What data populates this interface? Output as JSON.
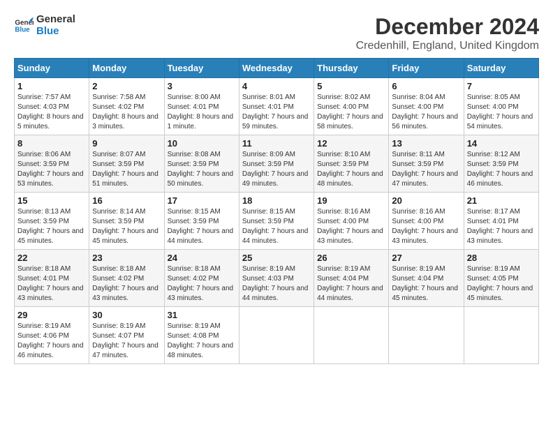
{
  "header": {
    "logo_line1": "General",
    "logo_line2": "Blue",
    "main_title": "December 2024",
    "subtitle": "Credenhill, England, United Kingdom"
  },
  "days_of_week": [
    "Sunday",
    "Monday",
    "Tuesday",
    "Wednesday",
    "Thursday",
    "Friday",
    "Saturday"
  ],
  "weeks": [
    [
      {
        "day": "1",
        "sunrise": "Sunrise: 7:57 AM",
        "sunset": "Sunset: 4:03 PM",
        "daylight": "Daylight: 8 hours and 5 minutes."
      },
      {
        "day": "2",
        "sunrise": "Sunrise: 7:58 AM",
        "sunset": "Sunset: 4:02 PM",
        "daylight": "Daylight: 8 hours and 3 minutes."
      },
      {
        "day": "3",
        "sunrise": "Sunrise: 8:00 AM",
        "sunset": "Sunset: 4:01 PM",
        "daylight": "Daylight: 8 hours and 1 minute."
      },
      {
        "day": "4",
        "sunrise": "Sunrise: 8:01 AM",
        "sunset": "Sunset: 4:01 PM",
        "daylight": "Daylight: 7 hours and 59 minutes."
      },
      {
        "day": "5",
        "sunrise": "Sunrise: 8:02 AM",
        "sunset": "Sunset: 4:00 PM",
        "daylight": "Daylight: 7 hours and 58 minutes."
      },
      {
        "day": "6",
        "sunrise": "Sunrise: 8:04 AM",
        "sunset": "Sunset: 4:00 PM",
        "daylight": "Daylight: 7 hours and 56 minutes."
      },
      {
        "day": "7",
        "sunrise": "Sunrise: 8:05 AM",
        "sunset": "Sunset: 4:00 PM",
        "daylight": "Daylight: 7 hours and 54 minutes."
      }
    ],
    [
      {
        "day": "8",
        "sunrise": "Sunrise: 8:06 AM",
        "sunset": "Sunset: 3:59 PM",
        "daylight": "Daylight: 7 hours and 53 minutes."
      },
      {
        "day": "9",
        "sunrise": "Sunrise: 8:07 AM",
        "sunset": "Sunset: 3:59 PM",
        "daylight": "Daylight: 7 hours and 51 minutes."
      },
      {
        "day": "10",
        "sunrise": "Sunrise: 8:08 AM",
        "sunset": "Sunset: 3:59 PM",
        "daylight": "Daylight: 7 hours and 50 minutes."
      },
      {
        "day": "11",
        "sunrise": "Sunrise: 8:09 AM",
        "sunset": "Sunset: 3:59 PM",
        "daylight": "Daylight: 7 hours and 49 minutes."
      },
      {
        "day": "12",
        "sunrise": "Sunrise: 8:10 AM",
        "sunset": "Sunset: 3:59 PM",
        "daylight": "Daylight: 7 hours and 48 minutes."
      },
      {
        "day": "13",
        "sunrise": "Sunrise: 8:11 AM",
        "sunset": "Sunset: 3:59 PM",
        "daylight": "Daylight: 7 hours and 47 minutes."
      },
      {
        "day": "14",
        "sunrise": "Sunrise: 8:12 AM",
        "sunset": "Sunset: 3:59 PM",
        "daylight": "Daylight: 7 hours and 46 minutes."
      }
    ],
    [
      {
        "day": "15",
        "sunrise": "Sunrise: 8:13 AM",
        "sunset": "Sunset: 3:59 PM",
        "daylight": "Daylight: 7 hours and 45 minutes."
      },
      {
        "day": "16",
        "sunrise": "Sunrise: 8:14 AM",
        "sunset": "Sunset: 3:59 PM",
        "daylight": "Daylight: 7 hours and 45 minutes."
      },
      {
        "day": "17",
        "sunrise": "Sunrise: 8:15 AM",
        "sunset": "Sunset: 3:59 PM",
        "daylight": "Daylight: 7 hours and 44 minutes."
      },
      {
        "day": "18",
        "sunrise": "Sunrise: 8:15 AM",
        "sunset": "Sunset: 3:59 PM",
        "daylight": "Daylight: 7 hours and 44 minutes."
      },
      {
        "day": "19",
        "sunrise": "Sunrise: 8:16 AM",
        "sunset": "Sunset: 4:00 PM",
        "daylight": "Daylight: 7 hours and 43 minutes."
      },
      {
        "day": "20",
        "sunrise": "Sunrise: 8:16 AM",
        "sunset": "Sunset: 4:00 PM",
        "daylight": "Daylight: 7 hours and 43 minutes."
      },
      {
        "day": "21",
        "sunrise": "Sunrise: 8:17 AM",
        "sunset": "Sunset: 4:01 PM",
        "daylight": "Daylight: 7 hours and 43 minutes."
      }
    ],
    [
      {
        "day": "22",
        "sunrise": "Sunrise: 8:18 AM",
        "sunset": "Sunset: 4:01 PM",
        "daylight": "Daylight: 7 hours and 43 minutes."
      },
      {
        "day": "23",
        "sunrise": "Sunrise: 8:18 AM",
        "sunset": "Sunset: 4:02 PM",
        "daylight": "Daylight: 7 hours and 43 minutes."
      },
      {
        "day": "24",
        "sunrise": "Sunrise: 8:18 AM",
        "sunset": "Sunset: 4:02 PM",
        "daylight": "Daylight: 7 hours and 43 minutes."
      },
      {
        "day": "25",
        "sunrise": "Sunrise: 8:19 AM",
        "sunset": "Sunset: 4:03 PM",
        "daylight": "Daylight: 7 hours and 44 minutes."
      },
      {
        "day": "26",
        "sunrise": "Sunrise: 8:19 AM",
        "sunset": "Sunset: 4:04 PM",
        "daylight": "Daylight: 7 hours and 44 minutes."
      },
      {
        "day": "27",
        "sunrise": "Sunrise: 8:19 AM",
        "sunset": "Sunset: 4:04 PM",
        "daylight": "Daylight: 7 hours and 45 minutes."
      },
      {
        "day": "28",
        "sunrise": "Sunrise: 8:19 AM",
        "sunset": "Sunset: 4:05 PM",
        "daylight": "Daylight: 7 hours and 45 minutes."
      }
    ],
    [
      {
        "day": "29",
        "sunrise": "Sunrise: 8:19 AM",
        "sunset": "Sunset: 4:06 PM",
        "daylight": "Daylight: 7 hours and 46 minutes."
      },
      {
        "day": "30",
        "sunrise": "Sunrise: 8:19 AM",
        "sunset": "Sunset: 4:07 PM",
        "daylight": "Daylight: 7 hours and 47 minutes."
      },
      {
        "day": "31",
        "sunrise": "Sunrise: 8:19 AM",
        "sunset": "Sunset: 4:08 PM",
        "daylight": "Daylight: 7 hours and 48 minutes."
      },
      null,
      null,
      null,
      null
    ]
  ]
}
